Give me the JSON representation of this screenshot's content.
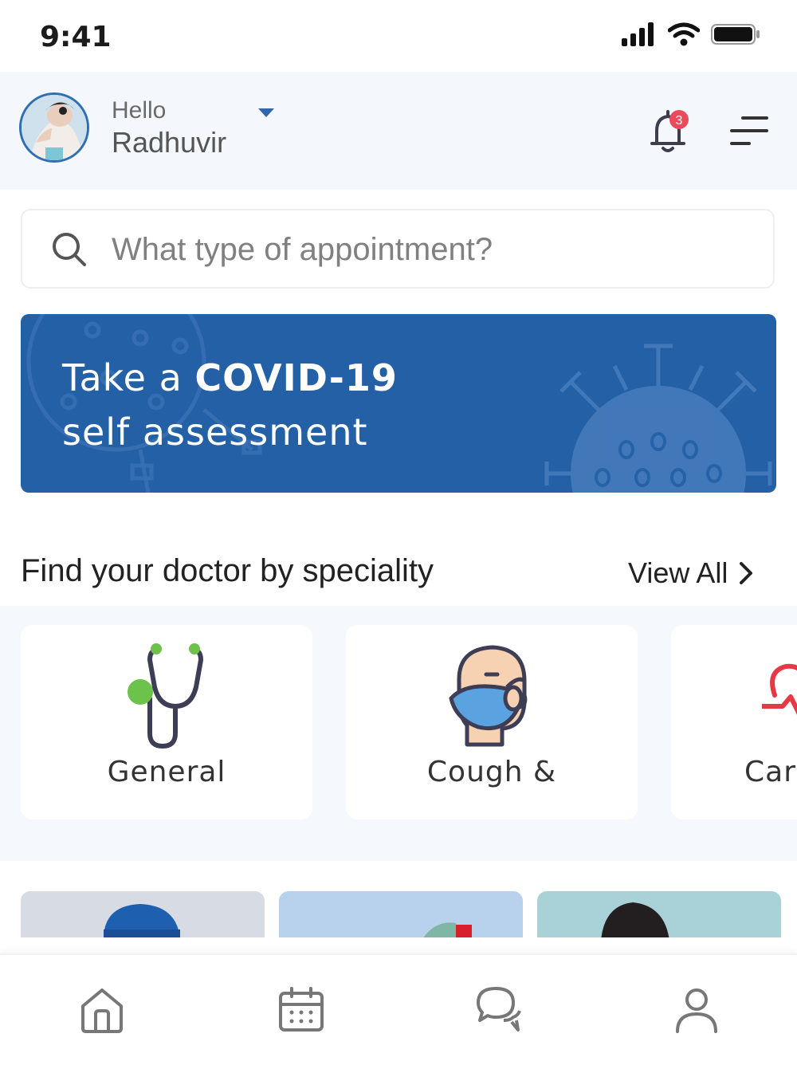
{
  "status_bar": {
    "time": "9:41"
  },
  "header": {
    "greeting": "Hello",
    "username": "Radhuvir",
    "notification_count": "3"
  },
  "search": {
    "placeholder": "What type of appointment?"
  },
  "banner": {
    "line1_prefix": "Take a ",
    "line1_emphasis": "COVID-19",
    "line2": "self assessment"
  },
  "speciality_section": {
    "title": "Find your doctor by speciality",
    "view_all_label": "View All",
    "cards": [
      {
        "label": "General",
        "icon": "stethoscope-icon"
      },
      {
        "label": "Cough &",
        "icon": "face-mask-icon"
      },
      {
        "label": "Car",
        "icon": "heart-pulse-icon"
      }
    ]
  },
  "bottom_nav": {
    "items": [
      {
        "icon": "home-icon"
      },
      {
        "icon": "calendar-icon"
      },
      {
        "icon": "chat-icon"
      },
      {
        "icon": "profile-icon"
      }
    ]
  },
  "colors": {
    "brand_blue": "#2460a6",
    "header_bg": "#f4f8fd",
    "badge_red": "#e94b5c",
    "stethoscope_green": "#6cc24a",
    "mask_blue": "#5aa3e0"
  }
}
